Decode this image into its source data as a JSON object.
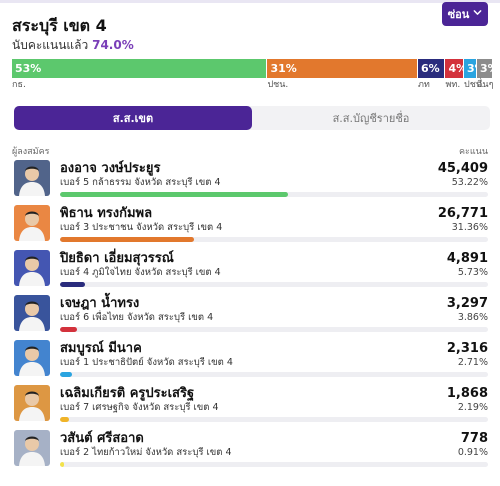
{
  "district": {
    "title": "สระบุรี เขต 4",
    "counted_label": "นับคะแนนแล้ว",
    "counted_pct": "74.0%",
    "hide_button_label": "ซ่อน"
  },
  "share_bar": [
    {
      "label": "53%",
      "party": "กธ.",
      "pct": 53.22,
      "color": "#5cc86d"
    },
    {
      "label": "31%",
      "party": "ปชน.",
      "pct": 31.36,
      "color": "#e2782d"
    },
    {
      "label": "6%",
      "party": "ภท",
      "pct": 5.73,
      "color": "#2a2c7d"
    },
    {
      "label": "4%",
      "party": "พท.",
      "pct": 3.86,
      "color": "#d3323c"
    },
    {
      "label": "3%",
      "party": "ปชป.",
      "pct": 2.71,
      "color": "#2aa4e0"
    },
    {
      "label": "3%",
      "party": "อื่นๆ",
      "pct": 3.12,
      "color": "#8c8c8c"
    }
  ],
  "tabs": [
    {
      "label": "ส.ส.เขต",
      "active": true
    },
    {
      "label": "ส.ส.บัญชีรายชื่อ",
      "active": false
    }
  ],
  "list_header": {
    "left": "ผู้ลงสมัคร",
    "right": "คะแนน"
  },
  "candidates": [
    {
      "name": "องอาจ วงษ์ประยูร",
      "detail": "เบอร์ 5 กล้าธรรม จังหวัด สระบุรี เขต 4",
      "votes": "45,409",
      "pct_label": "53.22%",
      "pct": 53.22,
      "color": "#5cc86d",
      "avatar": "#3a4f7a"
    },
    {
      "name": "พิธาน ทรงกัมพล",
      "detail": "เบอร์ 3 ประชาชน จังหวัด สระบุรี เขต 4",
      "votes": "26,771",
      "pct_label": "31.36%",
      "pct": 31.36,
      "color": "#e2782d",
      "avatar": "#e8772a"
    },
    {
      "name": "ปิยธิดา เอี่ยมสุวรรณ์",
      "detail": "เบอร์ 4 ภูมิใจไทย จังหวัด สระบุรี เขต 4",
      "votes": "4,891",
      "pct_label": "5.73%",
      "pct": 5.73,
      "color": "#2a2c7d",
      "avatar": "#2b3fa8"
    },
    {
      "name": "เจษฎา น้ำทรง",
      "detail": "เบอร์ 6 เพื่อไทย จังหวัด สระบุรี เขต 4",
      "votes": "3,297",
      "pct_label": "3.86%",
      "pct": 3.86,
      "color": "#d3323c",
      "avatar": "#1e3d8f"
    },
    {
      "name": "สมบูรณ์ มีนาค",
      "detail": "เบอร์ 1 ประชาธิปัตย์ จังหวัด สระบุรี เขต 4",
      "votes": "2,316",
      "pct_label": "2.71%",
      "pct": 2.71,
      "color": "#2aa4e0",
      "avatar": "#2a74c9"
    },
    {
      "name": "เฉลิมเกียรติ ครูประเสริฐ",
      "detail": "เบอร์ 7 เศรษฐกิจ จังหวัด สระบุรี เขต 4",
      "votes": "1,868",
      "pct_label": "2.19%",
      "pct": 2.19,
      "color": "#f0b429",
      "avatar": "#d9892a"
    },
    {
      "name": "วสันต์ ศรีสอาด",
      "detail": "เบอร์ 2 ไทยก้าวใหม่ จังหวัด สระบุรี เขต 4",
      "votes": "778",
      "pct_label": "0.91%",
      "pct": 0.91,
      "color": "#f2e24a",
      "avatar": "#9aa7bf"
    }
  ]
}
